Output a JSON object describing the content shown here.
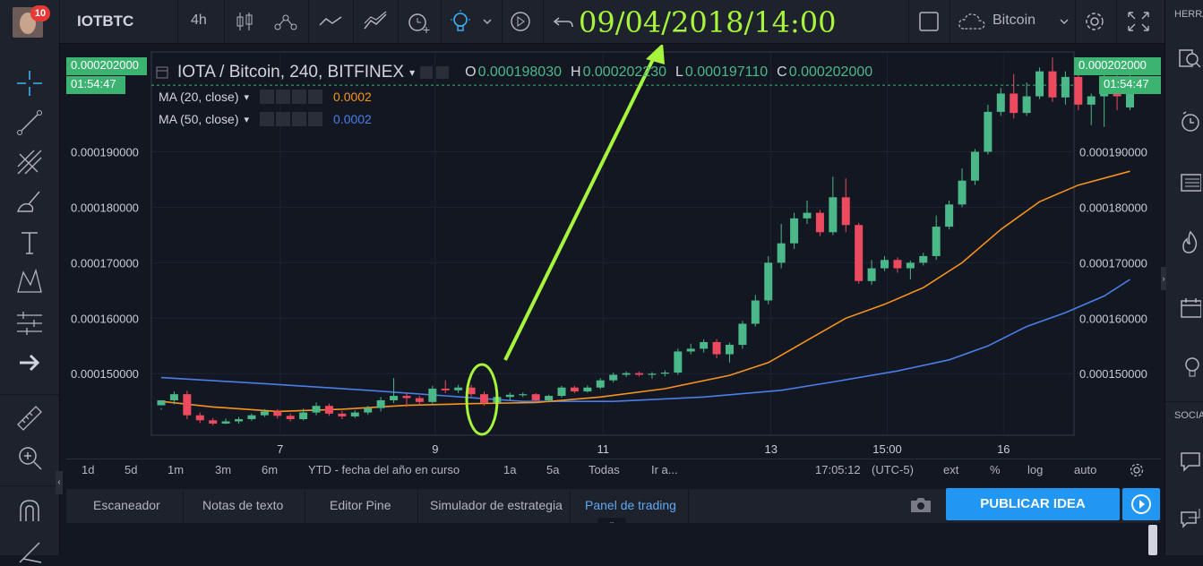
{
  "header": {
    "notification_count": "10",
    "symbol": "IOTBTC",
    "interval": "4h",
    "annotation_date": "09/04/2018/14:00",
    "compare_symbol": "Bitcoin"
  },
  "right_panel": {
    "label_top": "HERRA",
    "label_mid": "SOCIA"
  },
  "legend": {
    "title": "IOTA / Bitcoin, 240, BITFINEX",
    "o_label": "O",
    "o_value": "0.000198030",
    "h_label": "H",
    "h_value": "0.000202230",
    "l_label": "L",
    "l_value": "0.000197110",
    "c_label": "C",
    "c_value": "0.000202000",
    "ma20_label": "MA (20, close)",
    "ma20_value": "0.0002",
    "ma50_label": "MA (50, close)",
    "ma50_value": "0.0002"
  },
  "price_tag": {
    "price": "0.000202000",
    "countdown": "01:54:47"
  },
  "bottom_toolbar": {
    "ranges": [
      "1d",
      "5d",
      "1m",
      "3m",
      "6m",
      "YTD - fecha del año en curso",
      "1a",
      "5a",
      "Todas",
      "Ir a..."
    ],
    "time": "17:05:12",
    "tz": "(UTC-5)",
    "ext": "ext",
    "pct": "%",
    "log": "log",
    "auto": "auto"
  },
  "tabs": [
    "Escaneador",
    "Notas de texto",
    "Editor Pine",
    "Simulador de estrategia",
    "Panel de trading"
  ],
  "publish_button": "PUBLICAR IDEA",
  "colors": {
    "up": "#4bb88a",
    "down": "#ec4a5f",
    "ma20": "#f7931e",
    "ma50": "#4a7ee8",
    "annotation": "#a6f53c",
    "price_tag": "#3cb371",
    "accent": "#2196f3"
  },
  "chart_data": {
    "type": "candlestick",
    "x_tick_labels": [
      "7",
      "9",
      "11",
      "13",
      "15:00",
      "16"
    ],
    "y_tick_labels": [
      "0.000150000",
      "0.000160000",
      "0.000170000",
      "0.000180000",
      "0.000190000"
    ],
    "ylim": [
      0.0001389,
      0.000208
    ],
    "grid": true,
    "candles": [
      [
        0.0001443,
        0.0001452,
        0.0001438,
        0.0001435
      ],
      [
        0.0001452,
        0.0001463,
        0.0001445,
        0.0001468
      ],
      [
        0.0001463,
        0.0001425,
        0.0001418,
        0.0001469
      ],
      [
        0.0001425,
        0.0001416,
        0.0001411,
        0.000143
      ],
      [
        0.0001416,
        0.000141,
        0.0001407,
        0.000142
      ],
      [
        0.000141,
        0.0001414,
        0.0001409,
        0.0001419
      ],
      [
        0.0001414,
        0.0001418,
        0.000141,
        0.0001422
      ],
      [
        0.0001418,
        0.0001425,
        0.0001415,
        0.0001428
      ],
      [
        0.0001425,
        0.0001432,
        0.0001422,
        0.0001436
      ],
      [
        0.0001432,
        0.0001424,
        0.0001419,
        0.0001436
      ],
      [
        0.0001424,
        0.0001418,
        0.0001414,
        0.0001428
      ],
      [
        0.0001418,
        0.000143,
        0.0001416,
        0.0001437
      ],
      [
        0.000143,
        0.0001442,
        0.0001425,
        0.0001448
      ],
      [
        0.0001442,
        0.0001428,
        0.0001424,
        0.0001446
      ],
      [
        0.0001428,
        0.0001423,
        0.0001418,
        0.0001433
      ],
      [
        0.0001423,
        0.000143,
        0.000142,
        0.0001434
      ],
      [
        0.000143,
        0.0001438,
        0.0001426,
        0.0001442
      ],
      [
        0.0001438,
        0.0001452,
        0.0001432,
        0.0001458
      ],
      [
        0.0001452,
        0.000146,
        0.0001447,
        0.0001492
      ],
      [
        0.000146,
        0.0001456,
        0.000144,
        0.0001466
      ],
      [
        0.0001456,
        0.0001449,
        0.0001444,
        0.000146
      ],
      [
        0.0001449,
        0.0001473,
        0.0001446,
        0.0001478
      ],
      [
        0.0001473,
        0.000147,
        0.0001465,
        0.0001488
      ],
      [
        0.000147,
        0.0001475,
        0.0001465,
        0.000148
      ],
      [
        0.0001475,
        0.0001463,
        0.0001458,
        0.000148
      ],
      [
        0.0001463,
        0.0001448,
        0.0001442,
        0.0001468
      ],
      [
        0.0001448,
        0.0001458,
        0.0001445,
        0.0001462
      ],
      [
        0.0001458,
        0.0001462,
        0.0001452,
        0.0001466
      ],
      [
        0.0001462,
        0.0001463,
        0.0001458,
        0.0001466
      ],
      [
        0.0001463,
        0.0001452,
        0.0001448,
        0.0001465
      ],
      [
        0.0001452,
        0.000146,
        0.0001448,
        0.0001462
      ],
      [
        0.000146,
        0.0001475,
        0.0001457,
        0.0001478
      ],
      [
        0.0001475,
        0.0001468,
        0.0001465,
        0.0001478
      ],
      [
        0.0001468,
        0.0001475,
        0.0001466,
        0.0001479
      ],
      [
        0.0001475,
        0.0001488,
        0.0001472,
        0.0001492
      ],
      [
        0.0001488,
        0.0001498,
        0.0001484,
        0.0001502
      ],
      [
        0.0001498,
        0.0001501,
        0.0001494,
        0.0001504
      ],
      [
        0.0001501,
        0.0001498,
        0.0001495,
        0.0001504
      ],
      [
        0.0001498,
        0.00015,
        0.0001491,
        0.0001503
      ],
      [
        0.00015,
        0.0001502,
        0.0001495,
        0.0001506
      ],
      [
        0.0001502,
        0.000154,
        0.0001498,
        0.0001545
      ],
      [
        0.000154,
        0.0001545,
        0.0001535,
        0.0001554
      ],
      [
        0.0001545,
        0.0001557,
        0.0001538,
        0.0001562
      ],
      [
        0.0001557,
        0.0001535,
        0.0001528,
        0.0001562
      ],
      [
        0.0001535,
        0.0001552,
        0.000152,
        0.0001556
      ],
      [
        0.0001552,
        0.000159,
        0.0001545,
        0.0001595
      ],
      [
        0.000159,
        0.0001632,
        0.0001585,
        0.0001642
      ],
      [
        0.0001632,
        0.00017,
        0.0001625,
        0.0001712
      ],
      [
        0.00017,
        0.0001735,
        0.000169,
        0.000177
      ],
      [
        0.0001735,
        0.000178,
        0.0001725,
        0.000179
      ],
      [
        0.000178,
        0.000179,
        0.000177,
        0.0001812
      ],
      [
        0.000179,
        0.0001755,
        0.0001748,
        0.0001795
      ],
      [
        0.0001755,
        0.0001818,
        0.000175,
        0.0001855
      ],
      [
        0.0001818,
        0.0001768,
        0.0001755,
        0.0001852
      ],
      [
        0.0001768,
        0.0001667,
        0.0001662,
        0.0001772
      ],
      [
        0.0001667,
        0.000169,
        0.000166,
        0.0001705
      ],
      [
        0.000169,
        0.0001705,
        0.0001685,
        0.0001712
      ],
      [
        0.0001705,
        0.000169,
        0.0001682,
        0.000171
      ],
      [
        0.000169,
        0.00017,
        0.000167,
        0.0001704
      ],
      [
        0.00017,
        0.0001712,
        0.0001695,
        0.0001718
      ],
      [
        0.0001712,
        0.0001765,
        0.0001705,
        0.0001785
      ],
      [
        0.0001765,
        0.0001805,
        0.000176,
        0.0001812
      ],
      [
        0.0001805,
        0.0001848,
        0.00018,
        0.000187
      ],
      [
        0.0001848,
        0.00019,
        0.000184,
        0.0001905
      ],
      [
        0.00019,
        0.0001972,
        0.0001895,
        0.0001985
      ],
      [
        0.0001972,
        0.0002005,
        0.0001965,
        0.0002015
      ],
      [
        0.0002005,
        0.000197,
        0.000196,
        0.000204
      ],
      [
        0.000197,
        0.0002,
        0.0001965,
        0.0002025
      ],
      [
        0.0002,
        0.0002045,
        0.0001995,
        0.0002052
      ],
      [
        0.0002045,
        0.0001998,
        0.000199,
        0.000207
      ],
      [
        0.0001998,
        0.0002035,
        0.0001985,
        0.0002045
      ],
      [
        0.0002035,
        0.0001985,
        0.0001975,
        0.0002042
      ],
      [
        0.0001985,
        0.0002,
        0.0001948,
        0.0002005
      ],
      [
        0.0002,
        0.0002018,
        0.0001945,
        0.000204
      ],
      [
        0.0002018,
        0.0002,
        0.0001975,
        0.000206
      ],
      [
        0.000198,
        0.000202,
        0.0001975,
        0.000207
      ]
    ],
    "ma20": [
      [
        0,
        0.000145
      ],
      [
        4,
        0.000144
      ],
      [
        9,
        0.0001432
      ],
      [
        14,
        0.0001436
      ],
      [
        19,
        0.0001443
      ],
      [
        24,
        0.0001446
      ],
      [
        29,
        0.0001448
      ],
      [
        34,
        0.0001458
      ],
      [
        39,
        0.0001473
      ],
      [
        44,
        0.0001497
      ],
      [
        47,
        0.000152
      ],
      [
        50,
        0.000156
      ],
      [
        53,
        0.00016
      ],
      [
        56,
        0.0001625
      ],
      [
        59,
        0.0001655
      ],
      [
        62,
        0.00017
      ],
      [
        65,
        0.000176
      ],
      [
        68,
        0.000181
      ],
      [
        71,
        0.000184
      ],
      [
        75,
        0.0001865
      ]
    ],
    "ma50": [
      [
        0,
        0.0001493
      ],
      [
        8,
        0.0001482
      ],
      [
        16,
        0.000147
      ],
      [
        22,
        0.000146
      ],
      [
        28,
        0.000145
      ],
      [
        35,
        0.000145
      ],
      [
        42,
        0.0001458
      ],
      [
        48,
        0.000147
      ],
      [
        52,
        0.0001485
      ],
      [
        57,
        0.0001505
      ],
      [
        61,
        0.0001525
      ],
      [
        64,
        0.000155
      ],
      [
        67,
        0.0001585
      ],
      [
        70,
        0.000161
      ],
      [
        73,
        0.000164
      ],
      [
        75,
        0.000167
      ]
    ]
  }
}
